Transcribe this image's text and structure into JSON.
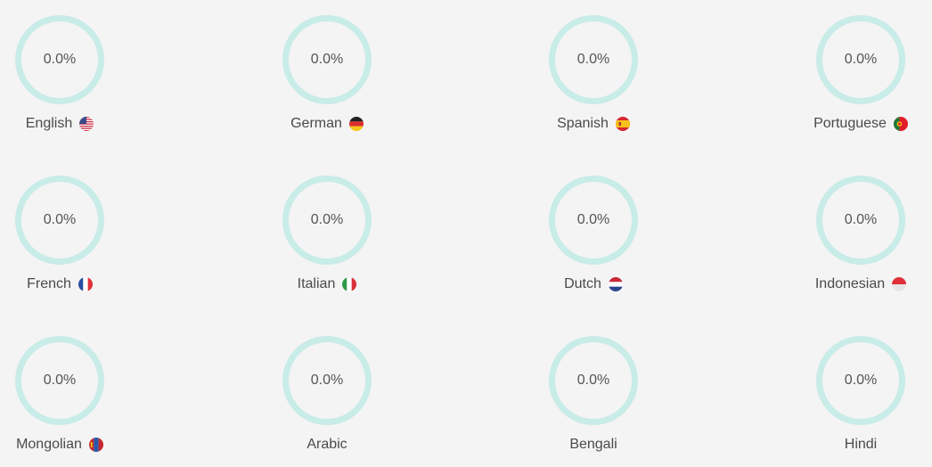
{
  "colors": {
    "background": "#f4f4f4",
    "ring_track": "#c8ece8",
    "ring_fill": "#3cc8b4",
    "text": "#4a4a4a"
  },
  "languages": [
    {
      "name": "English",
      "percent_label": "0.0%",
      "progress": 0.0,
      "flag": "us-flag-icon"
    },
    {
      "name": "German",
      "percent_label": "0.0%",
      "progress": 0.0,
      "flag": "de-flag-icon"
    },
    {
      "name": "Spanish",
      "percent_label": "0.0%",
      "progress": 0.0,
      "flag": "es-flag-icon"
    },
    {
      "name": "Portuguese",
      "percent_label": "0.0%",
      "progress": 0.0,
      "flag": "pt-flag-icon"
    },
    {
      "name": "French",
      "percent_label": "0.0%",
      "progress": 0.0,
      "flag": "fr-flag-icon"
    },
    {
      "name": "Italian",
      "percent_label": "0.0%",
      "progress": 0.0,
      "flag": "it-flag-icon"
    },
    {
      "name": "Dutch",
      "percent_label": "0.0%",
      "progress": 0.0,
      "flag": "nl-flag-icon"
    },
    {
      "name": "Indonesian",
      "percent_label": "0.0%",
      "progress": 0.0,
      "flag": "id-flag-icon"
    },
    {
      "name": "Mongolian",
      "percent_label": "0.0%",
      "progress": 0.0,
      "flag": "mn-flag-icon"
    },
    {
      "name": "Arabic",
      "percent_label": "0.0%",
      "progress": 0.0,
      "flag": ""
    },
    {
      "name": "Bengali",
      "percent_label": "0.0%",
      "progress": 0.0,
      "flag": ""
    },
    {
      "name": "Hindi",
      "percent_label": "0.0%",
      "progress": 0.0,
      "flag": ""
    }
  ]
}
